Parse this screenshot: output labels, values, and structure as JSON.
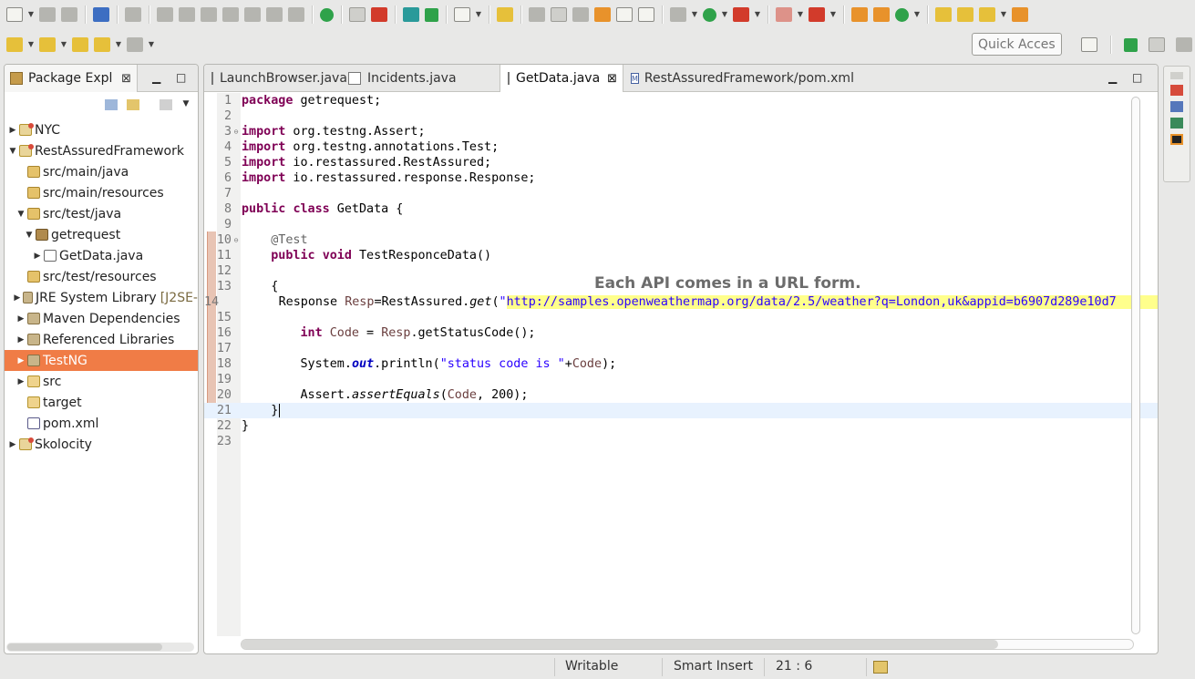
{
  "quick_access": {
    "placeholder": "Quick Access"
  },
  "package_explorer": {
    "title": "Package Expl",
    "close": "⊠",
    "tree": [
      {
        "label": "NYC",
        "indent": 0,
        "arrow": "▶",
        "icon": "project"
      },
      {
        "label": "RestAssuredFramework",
        "indent": 0,
        "arrow": "▼",
        "icon": "project"
      },
      {
        "label": "src/main/java",
        "indent": 1,
        "arrow": "",
        "icon": "source-folder"
      },
      {
        "label": "src/main/resources",
        "indent": 1,
        "arrow": "",
        "icon": "source-folder"
      },
      {
        "label": "src/test/java",
        "indent": 1,
        "arrow": "▼",
        "icon": "source-folder"
      },
      {
        "label": "getrequest",
        "indent": 2,
        "arrow": "▼",
        "icon": "package"
      },
      {
        "label": "GetData.java",
        "indent": 3,
        "arrow": "▶",
        "icon": "java-file"
      },
      {
        "label": "src/test/resources",
        "indent": 1,
        "arrow": "",
        "icon": "source-folder"
      },
      {
        "label": "JRE System Library",
        "suffix": "[J2SE-",
        "indent": 1,
        "arrow": "▶",
        "icon": "library"
      },
      {
        "label": "Maven Dependencies",
        "indent": 1,
        "arrow": "▶",
        "icon": "library"
      },
      {
        "label": "Referenced Libraries",
        "indent": 1,
        "arrow": "▶",
        "icon": "library"
      },
      {
        "label": "TestNG",
        "indent": 1,
        "arrow": "▶",
        "icon": "library",
        "selected": true
      },
      {
        "label": "src",
        "indent": 1,
        "arrow": "▶",
        "icon": "folder"
      },
      {
        "label": "target",
        "indent": 1,
        "arrow": "",
        "icon": "folder"
      },
      {
        "label": "pom.xml",
        "indent": 1,
        "arrow": "",
        "icon": "xml-file"
      },
      {
        "label": "Skolocity",
        "indent": 0,
        "arrow": "▶",
        "icon": "project"
      }
    ]
  },
  "editor": {
    "tabs": [
      {
        "label": "LaunchBrowser.java",
        "active": false
      },
      {
        "label": "Incidents.java",
        "active": false
      },
      {
        "label": "GetData.java",
        "active": true,
        "close": "⊠"
      },
      {
        "label": "RestAssuredFramework/pom.xml",
        "active": false,
        "icon_letter": "M"
      }
    ],
    "line_numbers": [
      "1",
      "2",
      "3",
      "4",
      "5",
      "6",
      "7",
      "8",
      "9",
      "10",
      "11",
      "12",
      "13",
      "14",
      "15",
      "16",
      "17",
      "18",
      "19",
      "20",
      "21",
      "22",
      "23"
    ],
    "code": {
      "l1_kw": "package",
      "l1_rest": " getrequest;",
      "l3_kw": "import",
      "l3_rest": " org.testng.Assert;",
      "l4_kw": "import",
      "l4_rest": " org.testng.annotations.Test;",
      "l5_kw": "import",
      "l5_rest": " io.restassured.RestAssured;",
      "l6_kw": "import",
      "l6_rest": " io.restassured.response.Response;",
      "l8_kw1": "public",
      "l8_kw2": "class",
      "l8_rest": " GetData {",
      "l10": "@Test",
      "l11_kw1": "public",
      "l11_kw2": "void",
      "l11_rest": " TestResponceData()",
      "l13": "{",
      "l14_a": "Response ",
      "l14_var": "Resp",
      "l14_b": "=RestAssured.",
      "l14_m": "get",
      "l14_c": "(",
      "l14_q": "\"",
      "l14_url": "http://samples.openweathermap.org/data/2.5/weather?q=London,uk&appid=b6907d289e10d7",
      "l16_kw": "int",
      "l16_var": " Code",
      "l16_a": " = ",
      "l16_var2": "Resp",
      "l16_b": ".getStatusCode();",
      "l18_a": "System.",
      "l18_fld": "out",
      "l18_b": ".println(",
      "l18_str": "\"status code is \"",
      "l18_c": "+",
      "l18_var": "Code",
      "l18_d": ");",
      "l20_a": "Assert.",
      "l20_m": "assertEquals",
      "l20_b": "(",
      "l20_var": "Code",
      "l20_c": ", 200);",
      "l21": "}",
      "l22": "}"
    },
    "annotation_note": "Each API comes in a URL form."
  },
  "status_bar": {
    "mode": "Writable",
    "insert": "Smart Insert",
    "position": "21 : 6"
  }
}
